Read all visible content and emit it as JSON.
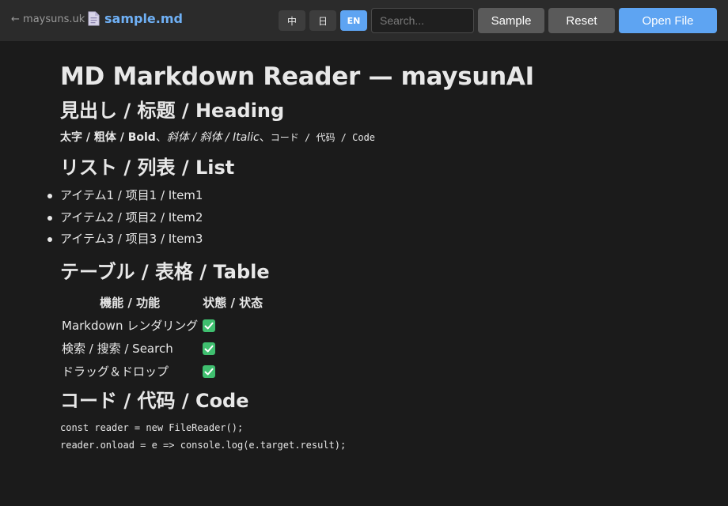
{
  "toolbar": {
    "back_label": "← maysuns.uk",
    "file_icon": "document-icon",
    "file_name": "sample.md",
    "languages": [
      "中",
      "日",
      "EN"
    ],
    "active_language": "EN",
    "search_placeholder": "Search...",
    "sample_label": "Sample",
    "reset_label": "Reset",
    "open_label": "Open File"
  },
  "colors": {
    "background": "#1b1b1b",
    "toolbar": "#2b2b2b",
    "accent": "#5ea4f2",
    "file_name": "#6fb0f5",
    "button": "#5a5a5a",
    "check_green": "#3fbf6f"
  },
  "document": {
    "title": "MD Markdown Reader — maysunAI",
    "sections": {
      "heading": {
        "title": "見出し / 标题 / Heading",
        "bold_text": "太字 / 粗体 / Bold",
        "separator1": "、",
        "italic_text": "斜体 / 斜体 / Italic",
        "separator2": "、",
        "code_text": "コード / 代码 / Code"
      },
      "list": {
        "title": "リスト / 列表 / List",
        "items": [
          "アイテム1 / 项目1 / Item1",
          "アイテム2 / 项目2 / Item2",
          "アイテム3 / 项目3 / Item3"
        ]
      },
      "table": {
        "title": "テーブル / 表格 / Table",
        "headers": [
          "機能 / 功能",
          "状態 / 状态"
        ],
        "rows": [
          {
            "feature": "Markdown レンダリング",
            "status": "check-icon"
          },
          {
            "feature": "検索 / 搜索 / Search",
            "status": "check-icon"
          },
          {
            "feature": "ドラッグ＆ドロップ",
            "status": "check-icon"
          }
        ]
      },
      "code": {
        "title": "コード / 代码 / Code",
        "lines": [
          "const reader = new FileReader();",
          "reader.onload = e => console.log(e.target.result);"
        ]
      }
    }
  }
}
